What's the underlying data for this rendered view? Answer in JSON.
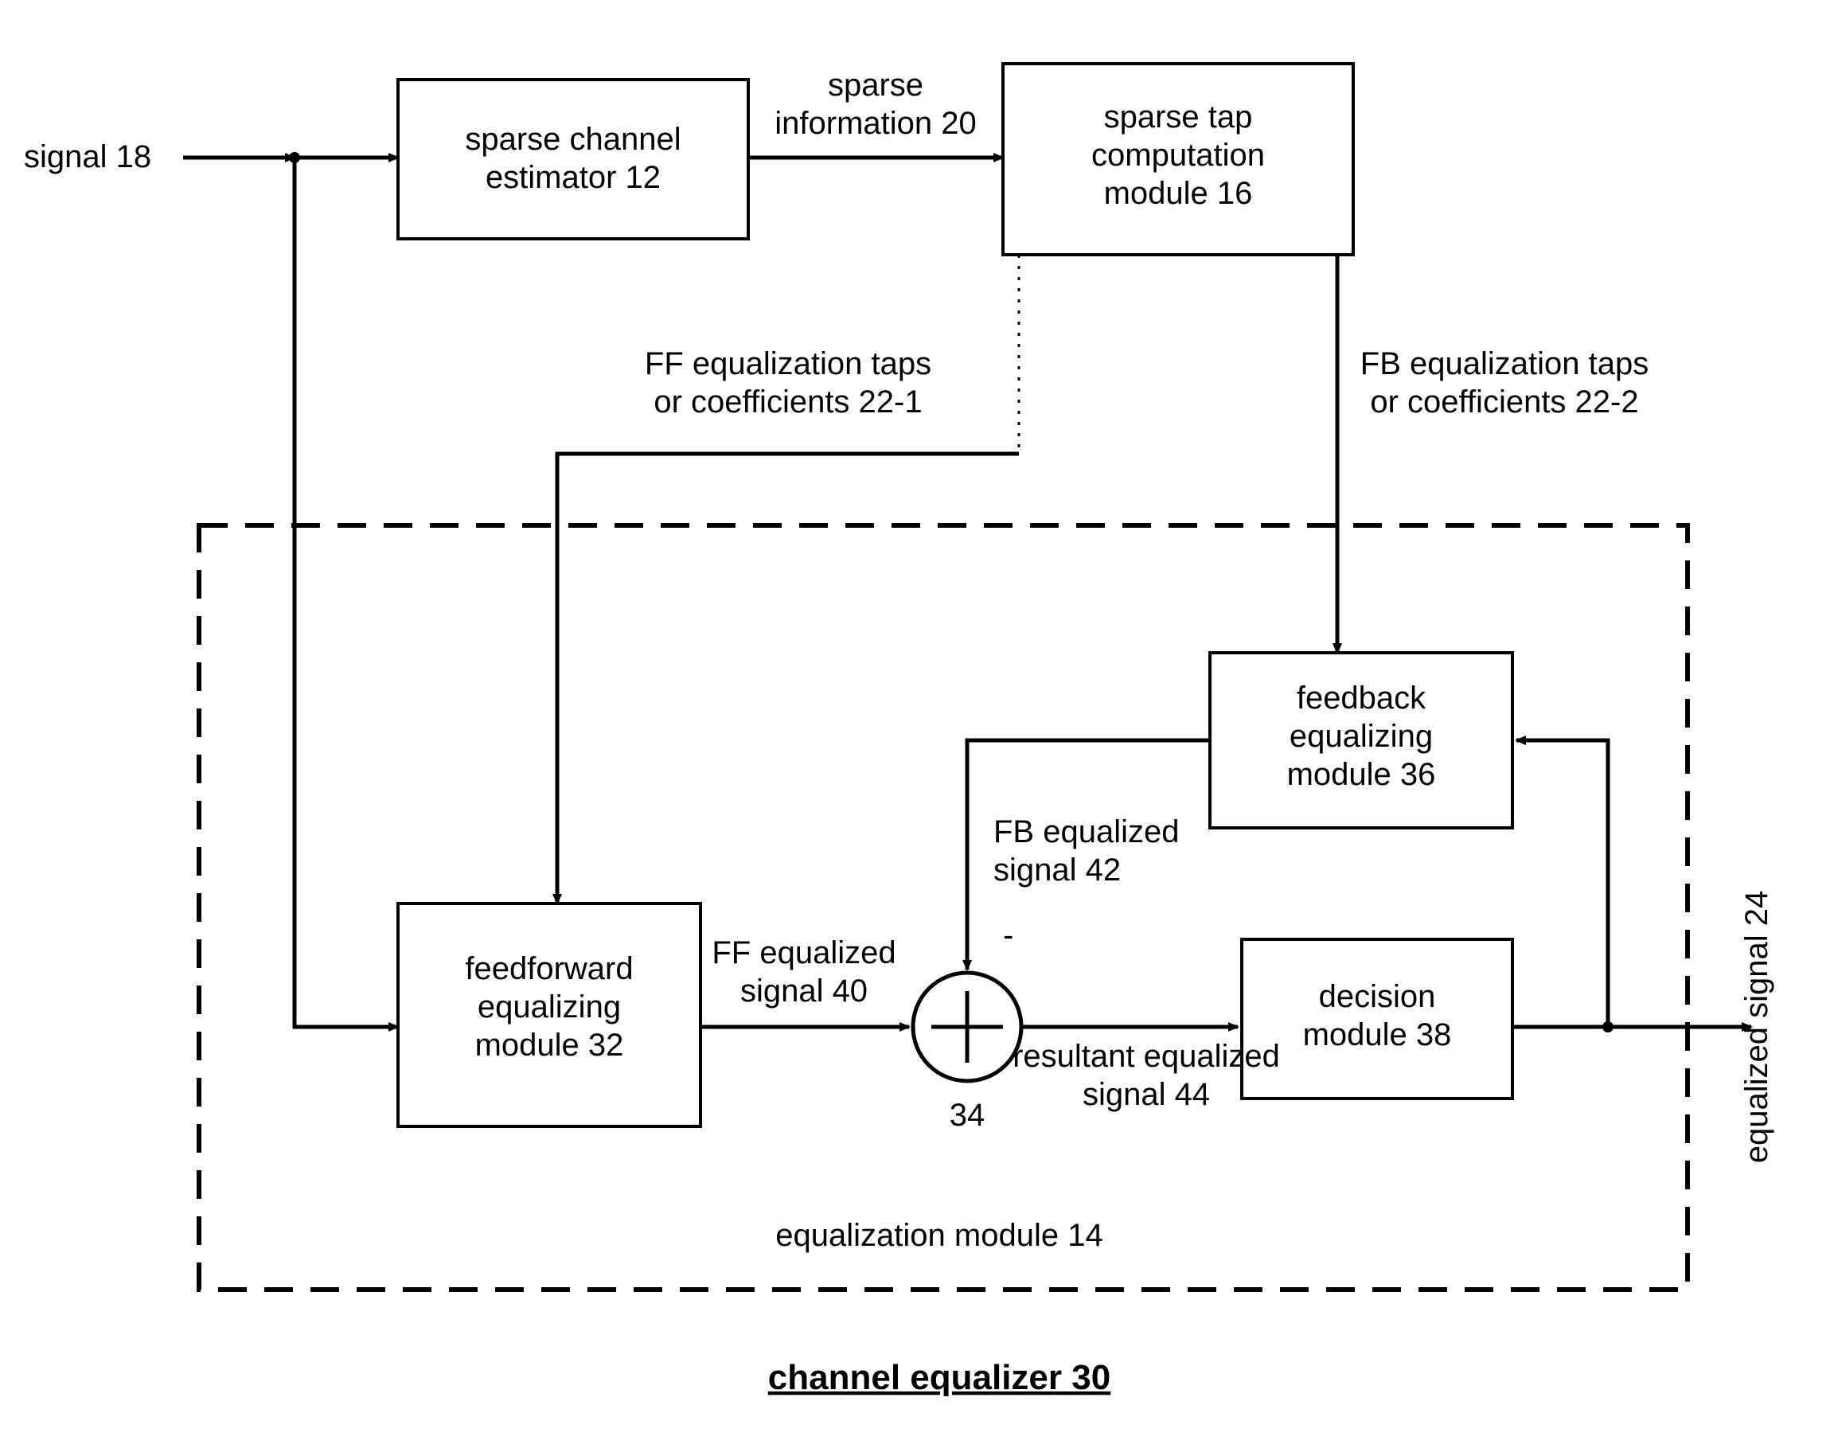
{
  "input_label": "signal 18",
  "boxes": {
    "estimator": [
      "sparse channel",
      "estimator 12"
    ],
    "sparse_tap": [
      "sparse tap",
      "computation",
      "module 16"
    ],
    "feedforward": [
      "feedforward",
      "equalizing",
      "module 32"
    ],
    "feedback": [
      "feedback",
      "equalizing",
      "module 36"
    ],
    "decision": [
      "decision",
      "module 38"
    ]
  },
  "arrows": {
    "sparse_info": [
      "sparse",
      "information 20"
    ],
    "ff_taps": [
      "FF equalization taps",
      "or coefficients 22-1"
    ],
    "fb_taps": [
      "FB equalization taps",
      "or coefficients 22-2"
    ],
    "fb_eq": [
      "FB equalized",
      "signal 42"
    ],
    "ff_eq": [
      "FF equalized",
      "signal 40"
    ],
    "resultant": [
      "resultant equalized",
      "signal 44"
    ],
    "minus": "-"
  },
  "sum_label": "34",
  "eq_module_label": "equalization module 14",
  "output_label": "equalized signal 24",
  "title": "channel equalizer 30"
}
